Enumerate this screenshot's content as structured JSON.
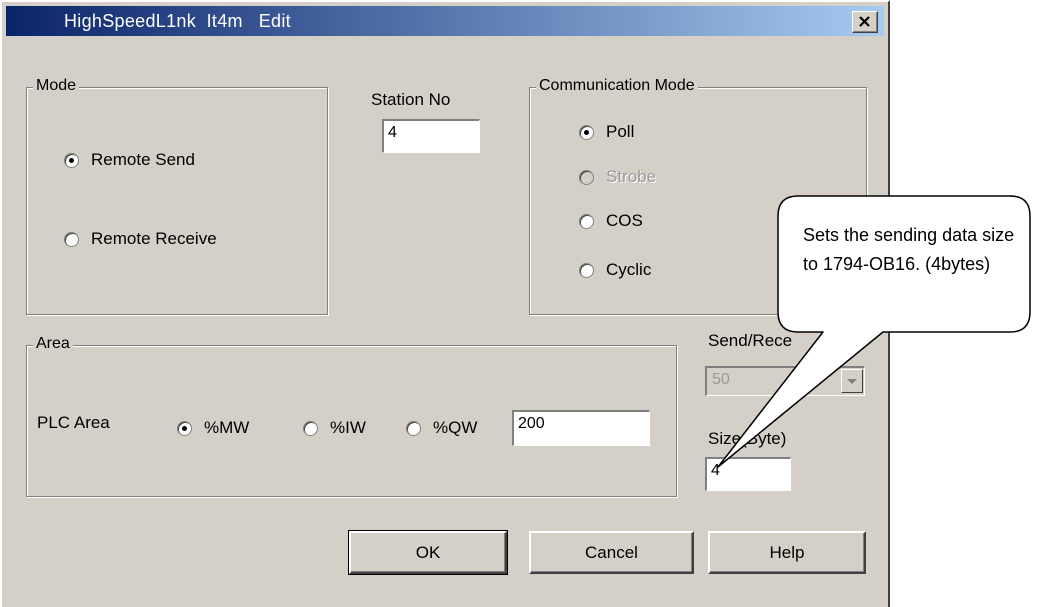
{
  "window": {
    "title": "HighSpeedL1nk  It4m   Edit"
  },
  "mode": {
    "label": "Mode",
    "options": [
      {
        "label": "Remote Send",
        "checked": true
      },
      {
        "label": "Remote Receive",
        "checked": false
      }
    ]
  },
  "station": {
    "label": "Station No",
    "value": "4"
  },
  "comm_mode": {
    "label": "Communication Mode",
    "options": [
      {
        "label": "Poll",
        "checked": true,
        "disabled": false
      },
      {
        "label": "Strobe",
        "checked": false,
        "disabled": true
      },
      {
        "label": "COS",
        "checked": false,
        "disabled": false
      },
      {
        "label": "Cyclic",
        "checked": false,
        "disabled": false
      }
    ]
  },
  "area": {
    "label": "Area",
    "plc_area_label": "PLC Area",
    "options": [
      {
        "label": "%MW",
        "checked": true
      },
      {
        "label": "%IW",
        "checked": false
      },
      {
        "label": "%QW",
        "checked": false
      }
    ],
    "value": "200"
  },
  "send_receive": {
    "label": "Send/Rece",
    "value": "50"
  },
  "size": {
    "label": "Size(Byte)",
    "value": "4"
  },
  "buttons": {
    "ok": "OK",
    "cancel": "Cancel",
    "help": "Help"
  },
  "callout": {
    "text": "Sets the sending data size to 1794-OB16. (4bytes)"
  },
  "icons": {
    "close": "close-icon",
    "dropdown": "chevron-down-icon"
  }
}
